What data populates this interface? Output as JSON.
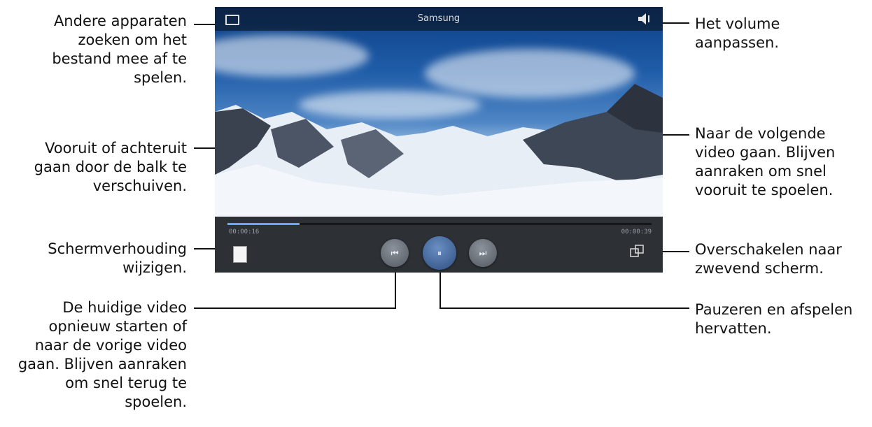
{
  "player": {
    "title": "Samsung",
    "elapsed": "00:00:16",
    "duration": "00:00:39",
    "progress": 0.17
  },
  "icons": {
    "cast": "screen-mirror-icon",
    "volume": "speaker-icon",
    "aspect": "aspect-ratio-icon",
    "previous": "previous-track-icon",
    "pause": "pause-icon",
    "next": "next-track-icon",
    "popup": "popup-player-icon"
  },
  "controls": {
    "prev_glyph": "⏮",
    "pause_glyph": "⏸",
    "next_glyph": "⏭"
  },
  "callouts": {
    "cast": "Andere apparaten\nzoeken om het\nbestand mee af te\nspelen.",
    "seek": "Vooruit of achteruit\ngaan door de balk te\nverschuiven.",
    "aspect": "Schermverhouding\nwijzigen.",
    "previous": "De huidige video\nopnieuw starten of\nnaar de vorige video\ngaan. Blijven aanraken\nom snel terug te\nspoelen.",
    "volume": "Het volume\naanpassen.",
    "next": "Naar de volgende\nvideo gaan. Blijven\naanraken om snel\nvooruit te spoelen.",
    "popup": "Overschakelen naar\nzwevend scherm.",
    "pause": "Pauzeren en afspelen\nhervatten."
  }
}
